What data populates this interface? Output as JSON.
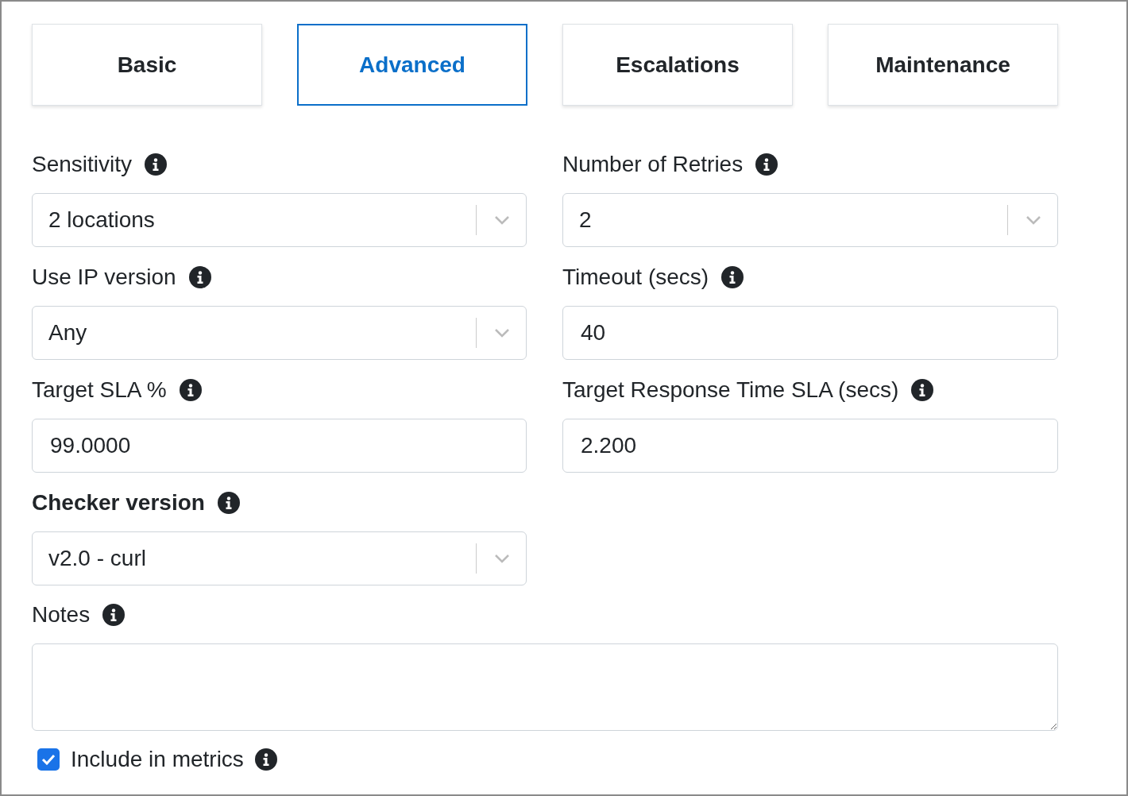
{
  "tabs": [
    {
      "label": "Basic",
      "selected": false
    },
    {
      "label": "Advanced",
      "selected": true
    },
    {
      "label": "Escalations",
      "selected": false
    },
    {
      "label": "Maintenance",
      "selected": false
    }
  ],
  "rows": [
    [
      {
        "label": "Sensitivity",
        "bold": false,
        "kind": "select",
        "value": "2 locations"
      },
      {
        "label": "Number of Retries",
        "bold": false,
        "kind": "select",
        "value": "2"
      }
    ],
    [
      {
        "label": "Use IP version",
        "bold": false,
        "kind": "select",
        "value": "Any"
      },
      {
        "label": "Timeout (secs)",
        "bold": false,
        "kind": "input",
        "value": "40"
      }
    ],
    [
      {
        "label": "Target SLA %",
        "bold": false,
        "kind": "input",
        "value": "99.0000"
      },
      {
        "label": "Target Response Time SLA (secs)",
        "bold": false,
        "kind": "input",
        "value": "2.200"
      }
    ],
    [
      {
        "label": "Checker version",
        "bold": true,
        "kind": "select",
        "value": "v2.0 - curl"
      }
    ]
  ],
  "notes": {
    "label": "Notes"
  },
  "include_in_metrics": {
    "label": "Include in metrics",
    "checked": true
  }
}
